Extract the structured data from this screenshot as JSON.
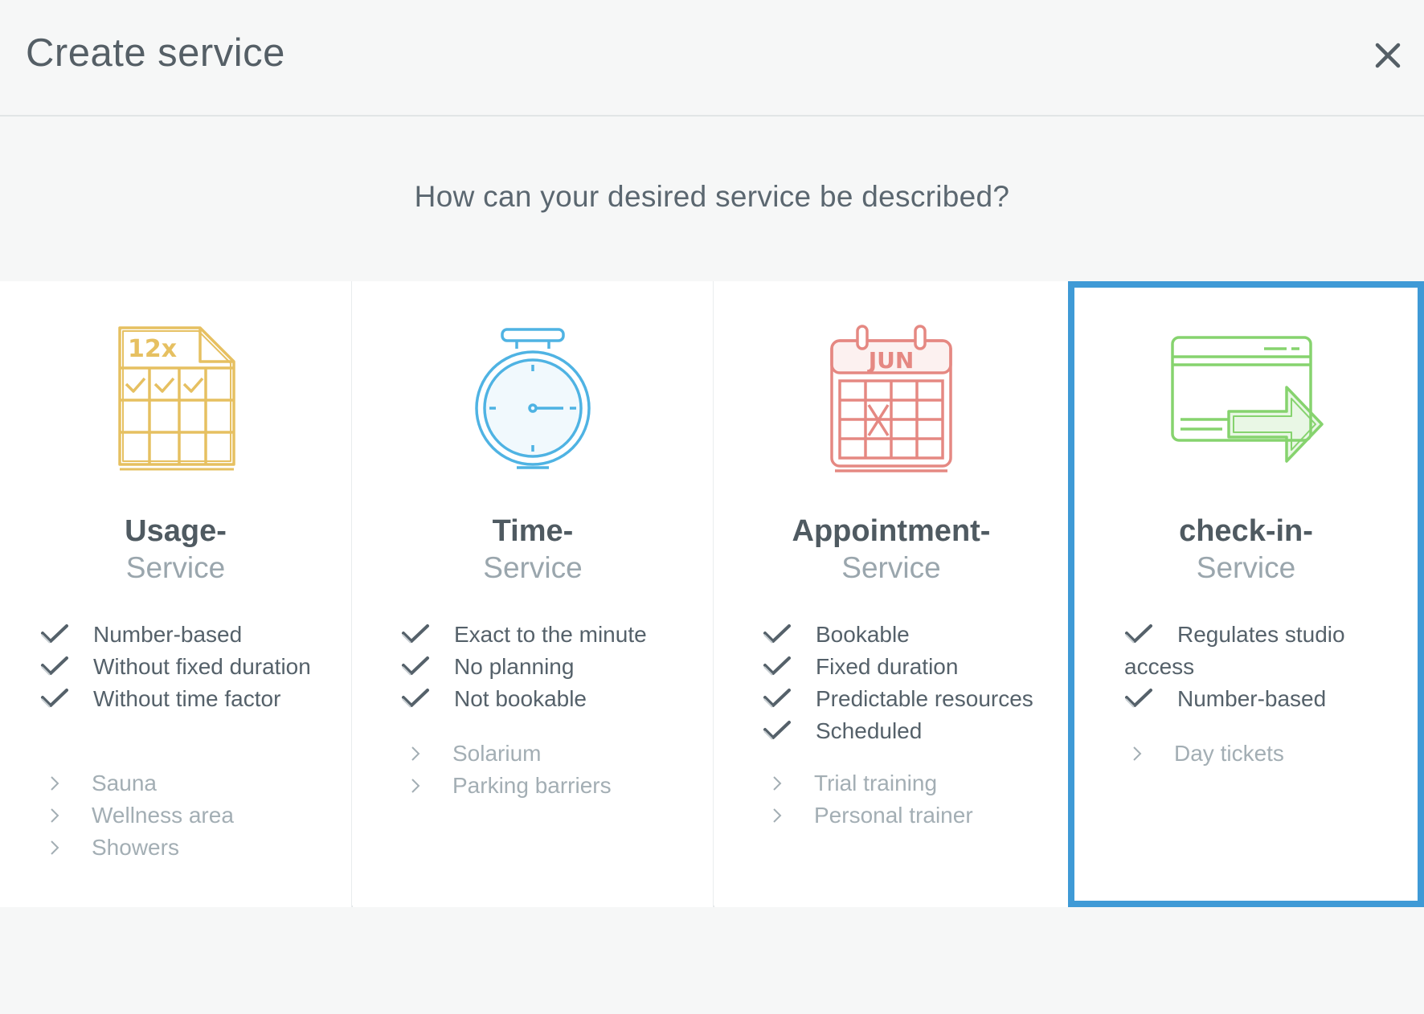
{
  "header": {
    "title": "Create service"
  },
  "question": "How can your desired service be described?",
  "cards": [
    {
      "title": "Usage-",
      "subtitle": "Service",
      "icon": "punch-card-12x-icon",
      "icon_text": "12x",
      "color": "#e6c061",
      "features": [
        "Number-based",
        "Without fixed duration",
        "Without time factor"
      ],
      "examples": [
        "Sauna",
        "Wellness area",
        "Showers"
      ]
    },
    {
      "title": "Time-",
      "subtitle": "Service",
      "icon": "stopwatch-icon",
      "color": "#4fb3e3",
      "features": [
        "Exact to the minute",
        "No planning",
        "Not bookable"
      ],
      "examples": [
        "Solarium",
        "Parking barriers"
      ]
    },
    {
      "title": "Appointment-",
      "subtitle": "Service",
      "icon": "calendar-jun-icon",
      "icon_text": "JUN",
      "color": "#e58882",
      "features": [
        "Bookable",
        "Fixed duration",
        "Predictable resources",
        "Scheduled"
      ],
      "examples": [
        "Trial training",
        "Personal trainer"
      ]
    },
    {
      "title": "check-in-",
      "subtitle": "Service",
      "icon": "card-checkin-arrow-icon",
      "color": "#86d36e",
      "selected": true,
      "features": [
        "Regulates studio access",
        "Number-based"
      ],
      "examples": [
        "Day tickets"
      ]
    }
  ],
  "colors": {
    "selected_border": "#3f9ad6",
    "background": "#f6f7f7",
    "card_background": "#ffffff"
  }
}
